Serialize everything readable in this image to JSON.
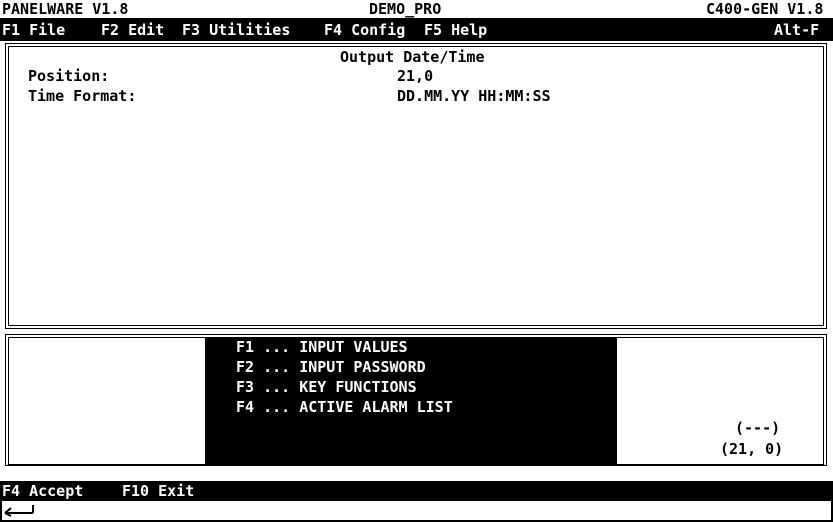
{
  "title_bar": {
    "app": "PANELWARE V1.8",
    "project": "DEMO_PRO",
    "target": "C400-GEN V1.8"
  },
  "menu": {
    "items": [
      "F1 File",
      "F2 Edit",
      "F3 Utilities",
      "F4 Config",
      "F5 Help"
    ],
    "shortcut": "Alt-F"
  },
  "panel": {
    "title": "Output Date/Time",
    "fields": [
      {
        "label": "Position:",
        "value": "21,0"
      },
      {
        "label": "Time Format:",
        "value": "DD.MM.YY HH:MM:SS"
      }
    ]
  },
  "key_help": {
    "lines": [
      "F1 ... INPUT VALUES",
      "F2 ... INPUT PASSWORD",
      "F3 ... KEY FUNCTIONS",
      "F4 ... ACTIVE ALARM LIST"
    ]
  },
  "indicator": {
    "state": "(---)",
    "coords": "(21, 0)"
  },
  "status_bar": {
    "accept": "F4 Accept",
    "exit": "F10 Exit"
  },
  "input_line": {
    "prompt_icon": "enter-arrow-icon"
  },
  "colors": {
    "foreground": "#000000",
    "background": "#ffffff"
  }
}
